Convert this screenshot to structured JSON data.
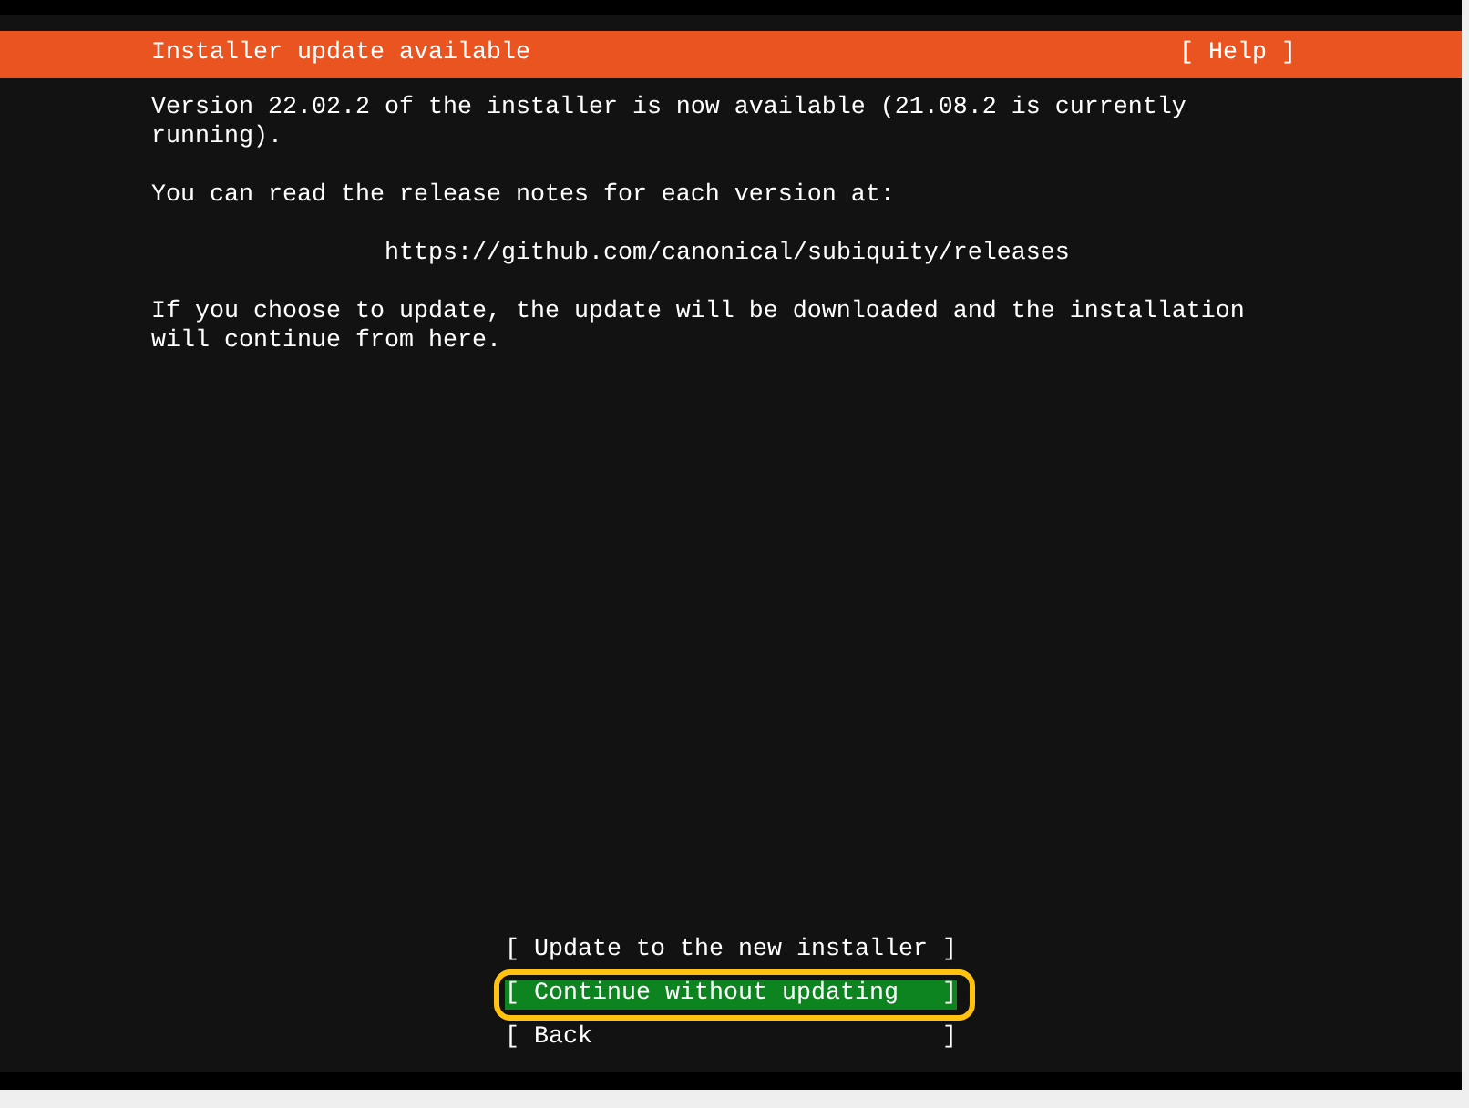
{
  "header": {
    "title": "Installer update available",
    "help": "[ Help ]"
  },
  "paragraphs": [
    {
      "kind": "text",
      "text": "Version 22.02.2 of the installer is now available (21.08.2 is currently running)."
    },
    {
      "kind": "text",
      "text": "You can read the release notes for each version at:"
    },
    {
      "kind": "url",
      "text": "https://github.com/canonical/subiquity/releases"
    },
    {
      "kind": "text",
      "text": "If you choose to update, the update will be downloaded and the installation will continue from here."
    }
  ],
  "buttons": [
    {
      "open": "[",
      "label": "Update to the new installer",
      "close": "]",
      "selected": false,
      "circled": false
    },
    {
      "open": "[",
      "label": "Continue without updating",
      "close": "]",
      "selected": true,
      "circled": true
    },
    {
      "open": "[",
      "label": "Back",
      "close": "]",
      "selected": false,
      "circled": false
    }
  ]
}
